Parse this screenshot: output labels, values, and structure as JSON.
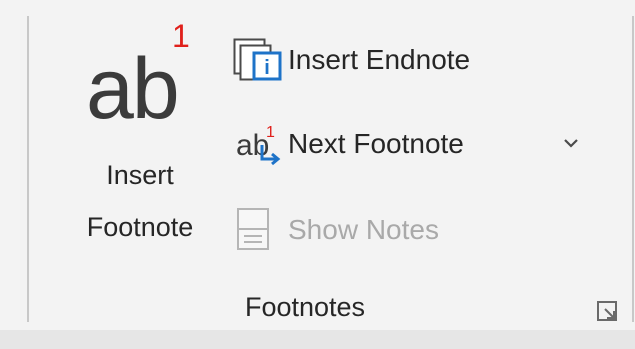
{
  "group": {
    "label": "Footnotes"
  },
  "insert_footnote": {
    "icon_text": "ab",
    "icon_superscript": "1",
    "label_line1": "Insert",
    "label_line2": "Footnote"
  },
  "insert_endnote": {
    "label": "Insert Endnote"
  },
  "next_footnote": {
    "label": "Next Footnote",
    "icon_text": "ab",
    "icon_superscript": "1"
  },
  "show_notes": {
    "label": "Show Notes",
    "enabled": false
  },
  "colors": {
    "accent_blue": "#1e73c8",
    "footnote_red": "#e0201b",
    "disabled_gray": "#a9a9a9"
  },
  "icons": {
    "insert_footnote": "ab-superscript-1-icon",
    "insert_endnote": "endnote-page-icon",
    "next_footnote": "next-footnote-icon",
    "show_notes": "show-notes-icon",
    "dropdown": "chevron-down-icon",
    "launcher": "dialog-launcher-icon"
  }
}
